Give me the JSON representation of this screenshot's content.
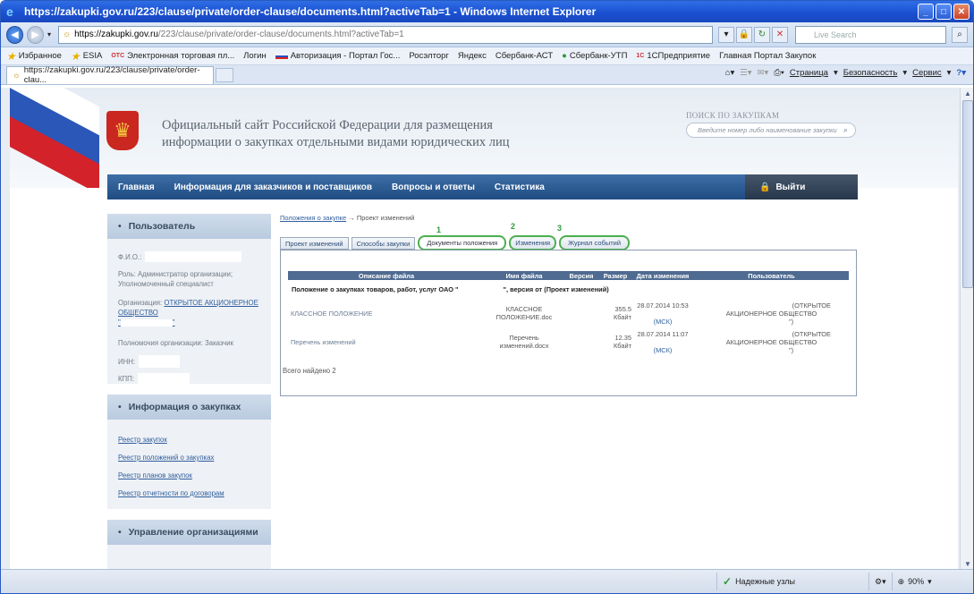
{
  "window": {
    "title": "https://zakupki.gov.ru/223/clause/private/order-clause/documents.html?activeTab=1 - Windows Internet Explorer"
  },
  "address_bar": {
    "url_host": "https://zakupki.gov.ru",
    "url_path": "/223/clause/private/order-clause/documents.html?activeTab=1",
    "search_placeholder": "Live Search"
  },
  "favorites": {
    "label": "Избранное",
    "items": [
      "ESIA",
      "Электронная торговая пл...",
      "Логин",
      "Авторизация - Портал Гос...",
      "Росэлторг",
      "Яндекс",
      "Сбербанк-АСТ",
      "Сбербанк-УТП",
      "1СПредприятие",
      "Главная Портал Закупок"
    ],
    "badge_otc": "OTC",
    "badge_1c": "1С"
  },
  "tab": {
    "label": "https://zakupki.gov.ru/223/clause/private/order-clau..."
  },
  "command_bar": {
    "page": "Страница",
    "safety": "Безопасность",
    "tools": "Сервис"
  },
  "site": {
    "title_line1": "Официальный сайт Российской Федерации для размещения",
    "title_line2": "информации о закупках отдельными видами юридических лиц",
    "search_label": "ПОИСК ПО ЗАКУПКАМ",
    "search_placeholder": "Введите номер либо наименование закупки",
    "nav": [
      "Главная",
      "Информация для заказчиков и поставщиков",
      "Вопросы и ответы",
      "Статистика"
    ],
    "logout": "Выйти"
  },
  "sidebar": {
    "user": {
      "title": "Пользователь",
      "fio_label": "Ф.И.О.:",
      "role": "Роль: Администратор организации; Уполномоченный специалист",
      "org_label": "Организация:",
      "org_link_1": "ОТКРЫТОЕ",
      "org_link_2": "АКЦИОНЕРНОЕ ОБЩЕСТВО",
      "org_link_3": "\"",
      "org_link_4": "\"",
      "powers": "Полномочия организации: Заказчик",
      "inn_label": "ИНН:",
      "kpp_label": "КПП:"
    },
    "info": {
      "title": "Информация о закупках",
      "links": [
        "Реестр закупок",
        "Реестр положений о закупках",
        "Реестр планов закупок",
        "Реестр отчетности по договорам"
      ]
    },
    "org_mgmt": {
      "title": "Управление организациями"
    }
  },
  "content": {
    "breadcrumb_link": "Положения о закупке",
    "breadcrumb_arrow": "→",
    "breadcrumb_current": "Проект изменений",
    "tabs": [
      "Проект изменений",
      "Способы закупки",
      "Документы положения",
      "Изменения",
      "Журнал событий"
    ],
    "tab_numbers": [
      "1",
      "2",
      "3"
    ],
    "table": {
      "headers": [
        "Описание файла",
        "Имя файла",
        "Версия",
        "Размер",
        "Дата изменения",
        "Пользователь"
      ],
      "group": "Положение о закупках товаров, работ, услуг ОАО \"",
      "group_tail": "\", версия от (Проект изменений)",
      "rows": [
        {
          "desc": "КЛАССНОЕ ПОЛОЖЕНИЕ",
          "name": "КЛАССНОЕ ПОЛОЖЕНИЕ.doc",
          "version": "",
          "size": "355.5 Кбайт",
          "date": "28.07.2014 10:53",
          "tz": "(МСК)",
          "user_tail": "(ОТКРЫТОЕ",
          "user": "АКЦИОНЕРНОЕ ОБЩЕСТВО",
          "user_end": "\")"
        },
        {
          "desc": "Перечень изменений",
          "name": "Перечень изменений.docx",
          "version": "",
          "size": "12.35 Кбайт",
          "date": "28.07.2014 11:07",
          "tz": "(МСК)",
          "user_tail": "(ОТКРЫТОЕ",
          "user": "АКЦИОНЕРНОЕ ОБЩЕСТВО",
          "user_end": "\")"
        }
      ],
      "total": "Всего найдено 2"
    }
  },
  "statusbar": {
    "zone": "Надежные узлы",
    "zoom": "90%"
  }
}
